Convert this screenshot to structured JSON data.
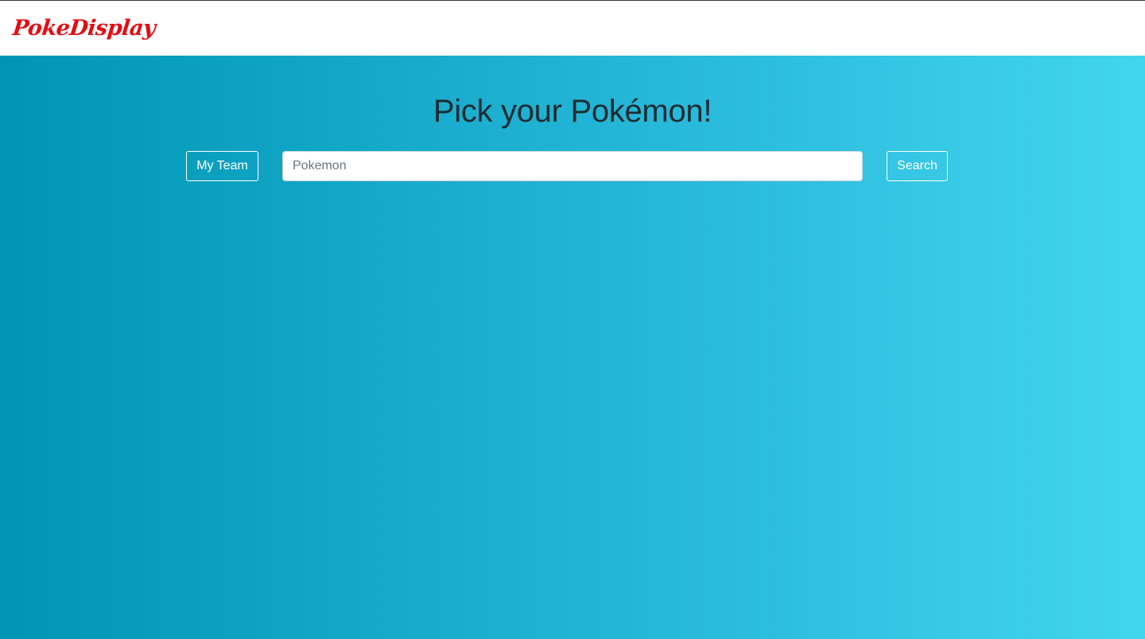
{
  "navbar": {
    "brand": "PokeDisplay",
    "brand_color": "#e30d13"
  },
  "hero": {
    "title": "Pick your Pokémon!",
    "gradient_start": "#0095b3",
    "gradient_end": "#42d5ee"
  },
  "controls": {
    "my_team_label": "My Team",
    "search_placeholder": "Pokemon",
    "search_value": "",
    "search_label": "Search"
  }
}
